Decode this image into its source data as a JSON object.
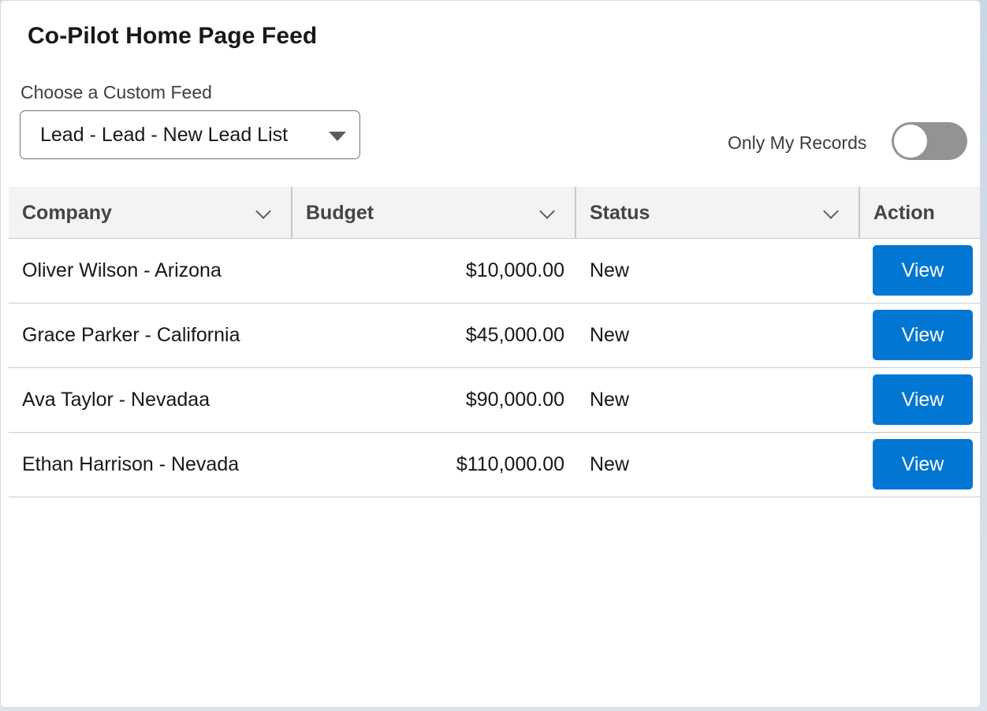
{
  "card": {
    "title": "Co-Pilot Home Page Feed"
  },
  "feed": {
    "label": "Choose a Custom Feed",
    "selected": "Lead - Lead - New Lead List"
  },
  "filter": {
    "label": "Only My Records",
    "enabled": false
  },
  "table": {
    "columns": [
      {
        "label": "Company"
      },
      {
        "label": "Budget"
      },
      {
        "label": "Status"
      },
      {
        "label": "Action"
      }
    ],
    "rows": [
      {
        "company": "Oliver Wilson - Arizona",
        "budget": "$10,000.00",
        "status": "New",
        "action": "View"
      },
      {
        "company": "Grace Parker - California",
        "budget": "$45,000.00",
        "status": "New",
        "action": "View"
      },
      {
        "company": "Ava Taylor - Nevadaa",
        "budget": "$90,000.00",
        "status": "New",
        "action": "View"
      },
      {
        "company": "Ethan Harrison - Nevada",
        "budget": "$110,000.00",
        "status": "New",
        "action": "View"
      }
    ]
  },
  "colors": {
    "brand_button": "#0176d3",
    "toggle_off": "#939393",
    "header_bg": "#f3f3f3"
  },
  "icons": {
    "select_caret": "caret-down-icon",
    "column_menu": "chevron-down-icon"
  }
}
